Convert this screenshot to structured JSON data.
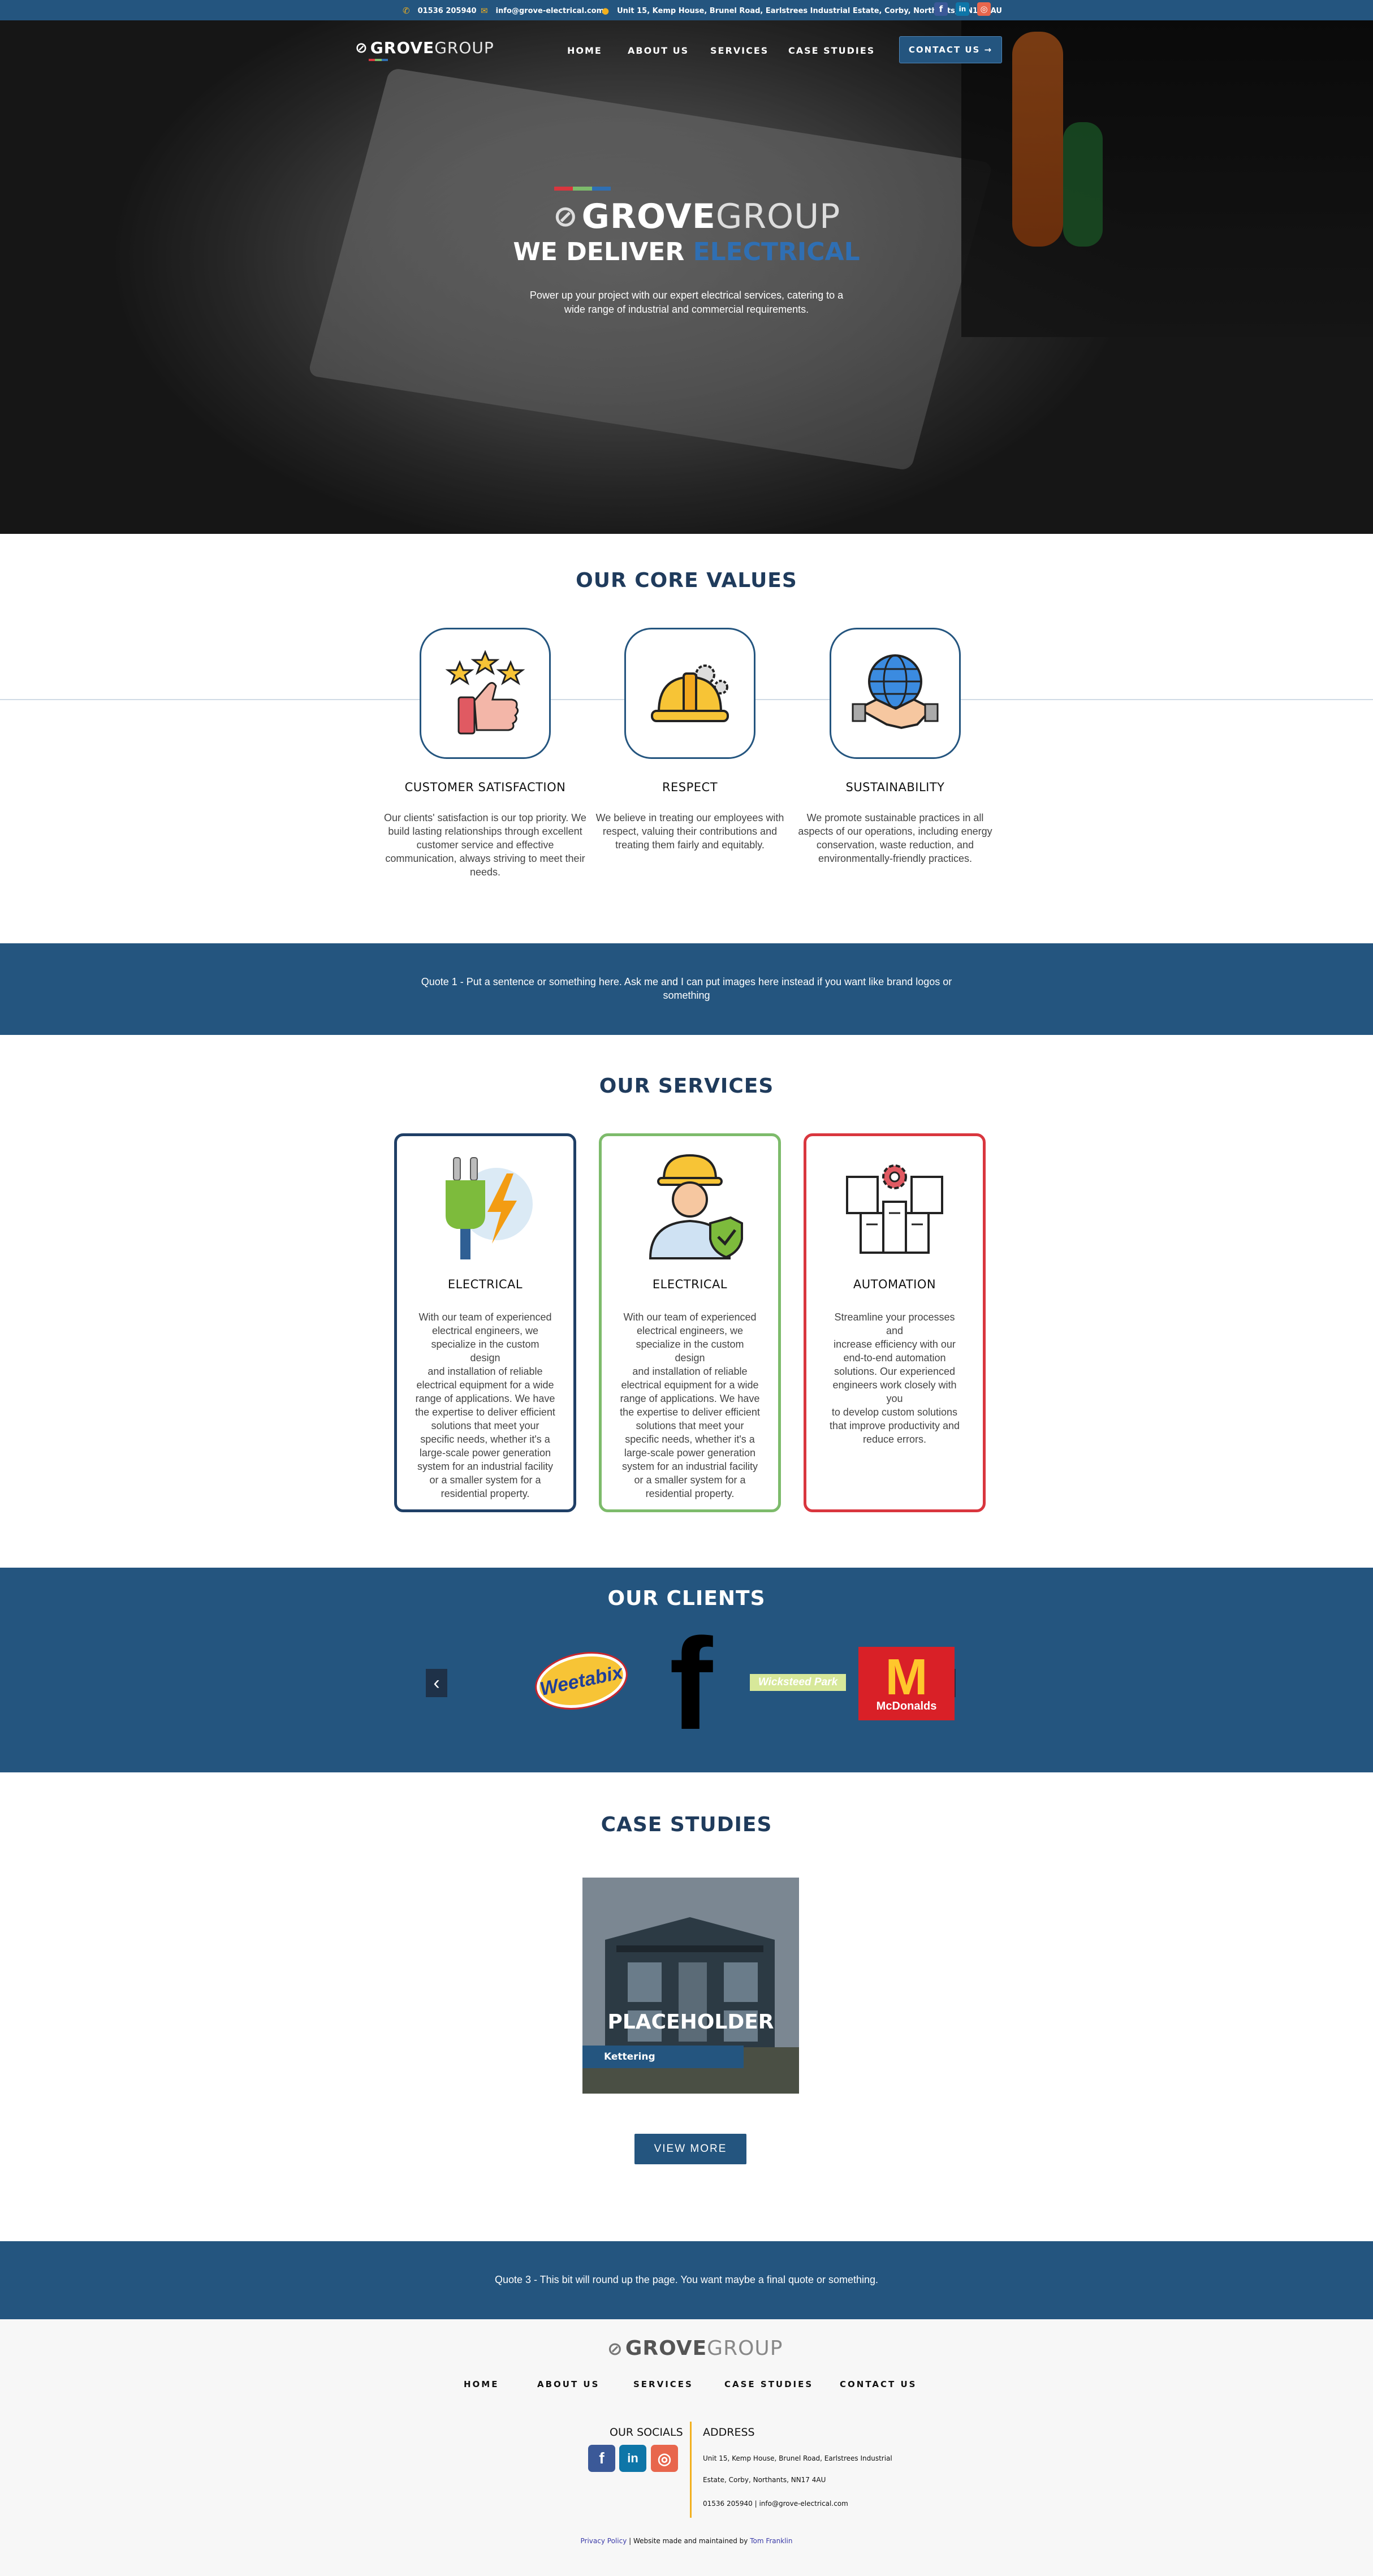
{
  "topbar": {
    "phone": "01536 205940",
    "email": "info@grove-electrical.com",
    "address": "Unit 15, Kemp House, Brunel Road, Earlstrees Industrial Estate, Corby, Northants, NN17 4AU",
    "socials": [
      "facebook-icon",
      "linkedin-icon",
      "instagram-icon"
    ],
    "social_glyphs": {
      "facebook": "f",
      "linkedin": "in",
      "instagram": "◎"
    }
  },
  "nav": {
    "logo_grove": "GROVE",
    "logo_group": "GROUP",
    "items": [
      "HOME",
      "ABOUT US",
      "SERVICES",
      "CASE STUDIES"
    ],
    "contact": "CONTACT US →"
  },
  "hero": {
    "logo_grove": "GROVE",
    "logo_group": "GROUP",
    "headline_white": "WE DELIVER",
    "headline_blue": "ELECTRICAL",
    "subtext_line1": "Power up your project with our expert electrical services, catering to a",
    "subtext_line2": "wide range of industrial and commercial requirements."
  },
  "core_values": {
    "title": "OUR CORE VALUES",
    "items": [
      {
        "icon": "thumbs-up-stars-icon",
        "heading": "CUSTOMER SATISFACTION",
        "lines": [
          "Our clients' satisfaction is our top priority. We",
          "build lasting relationships through excellent",
          "customer service and effective",
          "communication, always striving to meet their",
          "needs."
        ]
      },
      {
        "icon": "hard-hat-gears-icon",
        "heading": "RESPECT",
        "lines": [
          "We believe in treating our employees with",
          "respect, valuing their contributions and",
          "treating them fairly and equitably."
        ]
      },
      {
        "icon": "globe-handshake-icon",
        "heading": "SUSTAINABILITY",
        "lines": [
          "We promote sustainable practices in all",
          "aspects of our operations, including energy",
          "conservation, waste reduction, and",
          "environmentally-friendly practices."
        ]
      }
    ]
  },
  "quote1": {
    "line1": "Quote 1 - Put a sentence or something here. Ask me and I can put images here instead if you want like brand logos or",
    "line2": "something"
  },
  "services": {
    "title": "OUR SERVICES",
    "items": [
      {
        "icon": "plug-lightning-icon",
        "heading": "ELECTRICAL",
        "color": "#1f3f66",
        "lines": [
          "With our team of experienced",
          "electrical engineers, we",
          "specialize in the custom design",
          "and installation of reliable",
          "electrical equipment for a wide",
          "range of applications. We have",
          "the expertise to deliver efficient",
          "solutions that meet your",
          "specific needs, whether it's a",
          "large-scale power generation",
          "system for an industrial facility",
          "or a smaller system for a",
          "residential property."
        ]
      },
      {
        "icon": "engineer-shield-icon",
        "heading": "ELECTRICAL",
        "color": "#7dbb6b",
        "lines": [
          "With our team of experienced",
          "electrical engineers, we",
          "specialize in the custom design",
          "and installation of reliable",
          "electrical equipment for a wide",
          "range of applications. We have",
          "the expertise to deliver efficient",
          "solutions that meet your",
          "specific needs, whether it's a",
          "large-scale power generation",
          "system for an industrial facility",
          "or a smaller system for a",
          "residential property."
        ]
      },
      {
        "icon": "automation-gear-icon",
        "heading": "AUTOMATION",
        "color": "#d9363e",
        "lines": [
          "Streamline your processes and",
          "increase efficiency with our",
          "end-to-end automation",
          "solutions. Our experienced",
          "engineers work closely with you",
          "to develop custom solutions",
          "that improve productivity and",
          "reduce errors."
        ]
      }
    ]
  },
  "clients": {
    "title": "OUR CLIENTS",
    "prev": "‹",
    "next": "›",
    "logos": {
      "weetabix": "Weetabix",
      "facebook": "f",
      "wicksteed": "Wicksteed Park",
      "mcdonalds": "McDonalds"
    }
  },
  "case_studies": {
    "title": "CASE STUDIES",
    "card_title": "PLACEHOLDER",
    "card_location": "Kettering",
    "view_more": "VIEW MORE"
  },
  "quote3": {
    "text": "Quote 3 - This bit will round up the page. You want maybe a final quote or something."
  },
  "footer": {
    "logo_grove": "GROVE",
    "logo_group": "GROUP",
    "nav": [
      "HOME",
      "ABOUT US",
      "SERVICES",
      "CASE STUDIES",
      "CONTACT US"
    ],
    "socials_heading": "OUR SOCIALS",
    "address_heading": "ADDRESS",
    "address_line1": "Unit 15, Kemp House, Brunel Road, Earlstrees Industrial",
    "address_line2": "Estate, Corby, Northants, NN17 4AU",
    "contact_line": "01536 205940 | info@grove-electrical.com",
    "privacy": "Privacy Policy",
    "credit_mid": " | Website made and maintained by ",
    "credit_name": "Tom Franklin"
  },
  "colors": {
    "primary": "#24557f",
    "accent_gold": "#f2b01e",
    "title_navy": "#1f3b5c",
    "electric_blue": "#2f6fb3"
  }
}
